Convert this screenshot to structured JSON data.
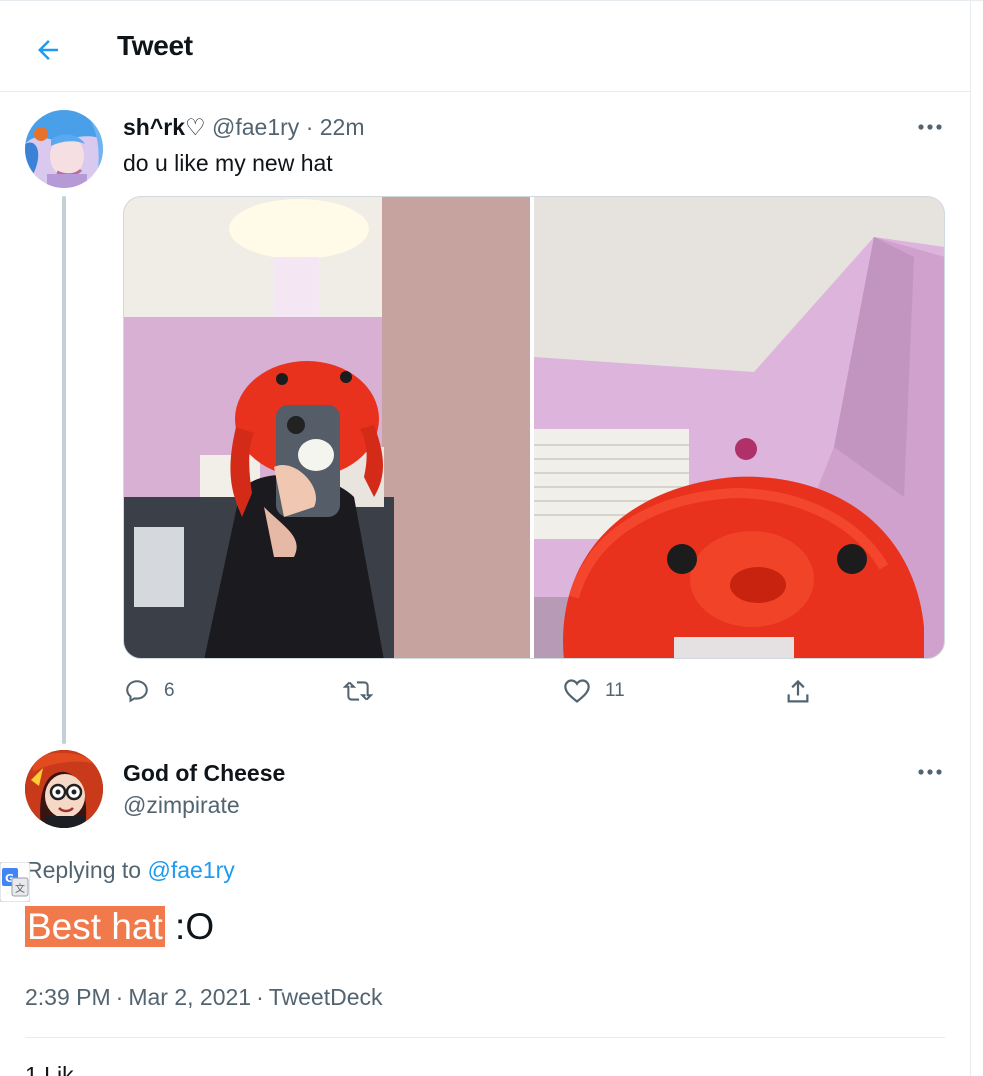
{
  "header": {
    "title": "Tweet"
  },
  "original_tweet": {
    "display_name": "sh^rk♡",
    "handle": "@fae1ry",
    "separator": "·",
    "time_ago": "22m",
    "text": "do u like my new hat",
    "actions": {
      "replies": "6",
      "retweets": "",
      "likes": "11"
    }
  },
  "reply_tweet": {
    "display_name": "God of Cheese",
    "handle": "@zimpirate",
    "replying_label": "Replying to ",
    "replying_handle": "@fae1ry",
    "text_highlight": "Best hat",
    "text_rest": " :O",
    "time": "2:39 PM",
    "date": "Mar 2, 2021",
    "source": "TweetDeck",
    "separator": "·",
    "likes_peek": "1 Lik"
  },
  "colors": {
    "accent": "#1d9bf0",
    "highlight": "#f07a4c",
    "muted": "#536471",
    "hat_red": "#e8321e",
    "wall_pink": "#dcb4dc"
  }
}
